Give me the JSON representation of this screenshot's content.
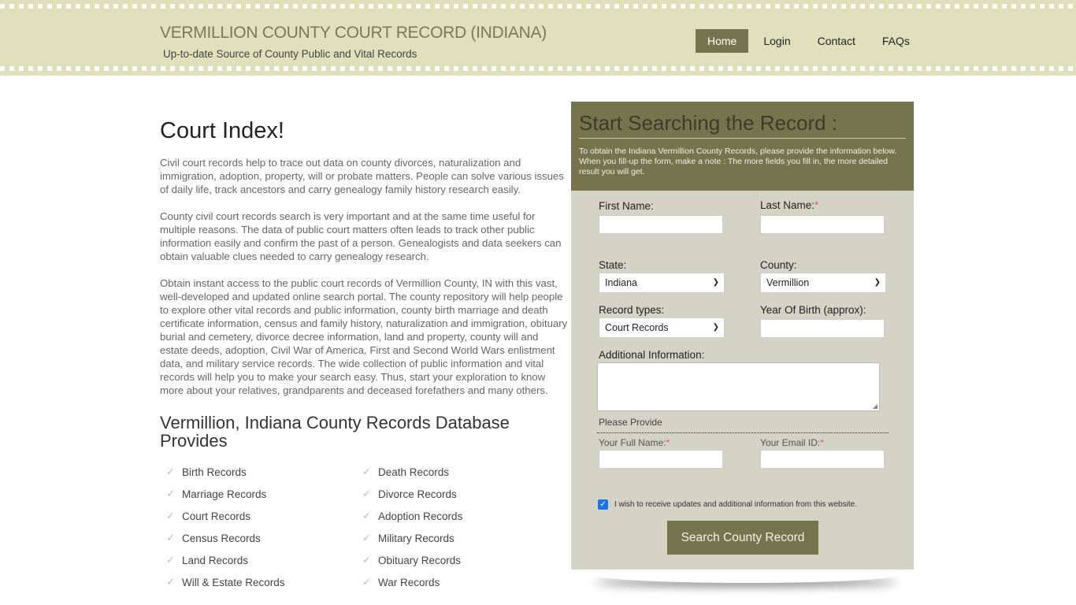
{
  "header": {
    "site_title": "VERMILLION COUNTY COURT RECORD (INDIANA)",
    "subtitle": "Up-to-date Source of  County Public and Vital Records",
    "nav": [
      {
        "label": "Home",
        "active": true
      },
      {
        "label": "Login",
        "active": false
      },
      {
        "label": "Contact",
        "active": false
      },
      {
        "label": "FAQs",
        "active": false
      }
    ]
  },
  "main": {
    "title": "Court Index!",
    "paragraphs": [
      "Civil court records help to trace out data on county divorces, naturalization and immigration, adoption, property, will or probate matters. People can solve various issues of daily life, track ancestors and carry genealogy family history research easily.",
      "County civil court records search is very important and at the same time useful for multiple reasons. The data of public court matters often leads to track other public information easily and confirm the past of a person. Genealogists and data seekers can obtain valuable clues needed to carry genealogy research.",
      "Obtain instant access to the public court records of Vermillion County, IN with this vast, well-developed and updated online search portal. The county repository will help people to explore other vital records and public information, county birth marriage and death certificate information, census and family history, naturalization and immigration, obituary burial and cemetery, divorce decree information, land and property, county will and estate deeds, adoption, Civil War of America, First and Second World Wars enlistment data, and military service records. The wide collection of public information and vital records will help you to make your search easy. Thus, start your exploration to know more about your relatives, grandparents and deceased forefathers and many others."
    ],
    "database_heading": "Vermillion, Indiana County Records Database Provides",
    "records": [
      "Birth Records",
      "Death Records",
      "Marriage Records",
      "Divorce Records",
      "Court Records",
      "Adoption Records",
      "Census Records",
      "Military Records",
      "Land Records",
      "Obituary Records",
      "Will & Estate Records",
      "War Records"
    ]
  },
  "form": {
    "title": "Start Searching the Record :",
    "description": "To obtain the Indiana Vermillion County Records, please provide the information below. When you fill-up the form, make a note : The more fields you fill in, the more detailed result you will get.",
    "first_name_label": "First Name:",
    "first_name_value": "",
    "last_name_label": "Last Name:",
    "last_name_value": "",
    "required_mark": "*",
    "state_label": "State:",
    "state_value": "Indiana",
    "county_label": "County:",
    "county_value": "Vermillion",
    "record_types_label": "Record types:",
    "record_types_value": "Court Records",
    "yob_label": "Year Of Birth (approx):",
    "yob_value": "",
    "additional_label": "Additional Information:",
    "additional_value": "",
    "please_provide": "Please Provide",
    "full_name_label": "Your Full Name:",
    "full_name_value": "",
    "email_label": "Your Email ID:",
    "email_value": "",
    "consent_text": "I wish to receive updates and additional information from this website.",
    "consent_checked": true,
    "submit_label": "Search County Record"
  },
  "colors": {
    "header_bg": "#e1e0bd",
    "accent": "#76744f",
    "form_bg": "#d3d3c6",
    "required": "#e06060"
  }
}
